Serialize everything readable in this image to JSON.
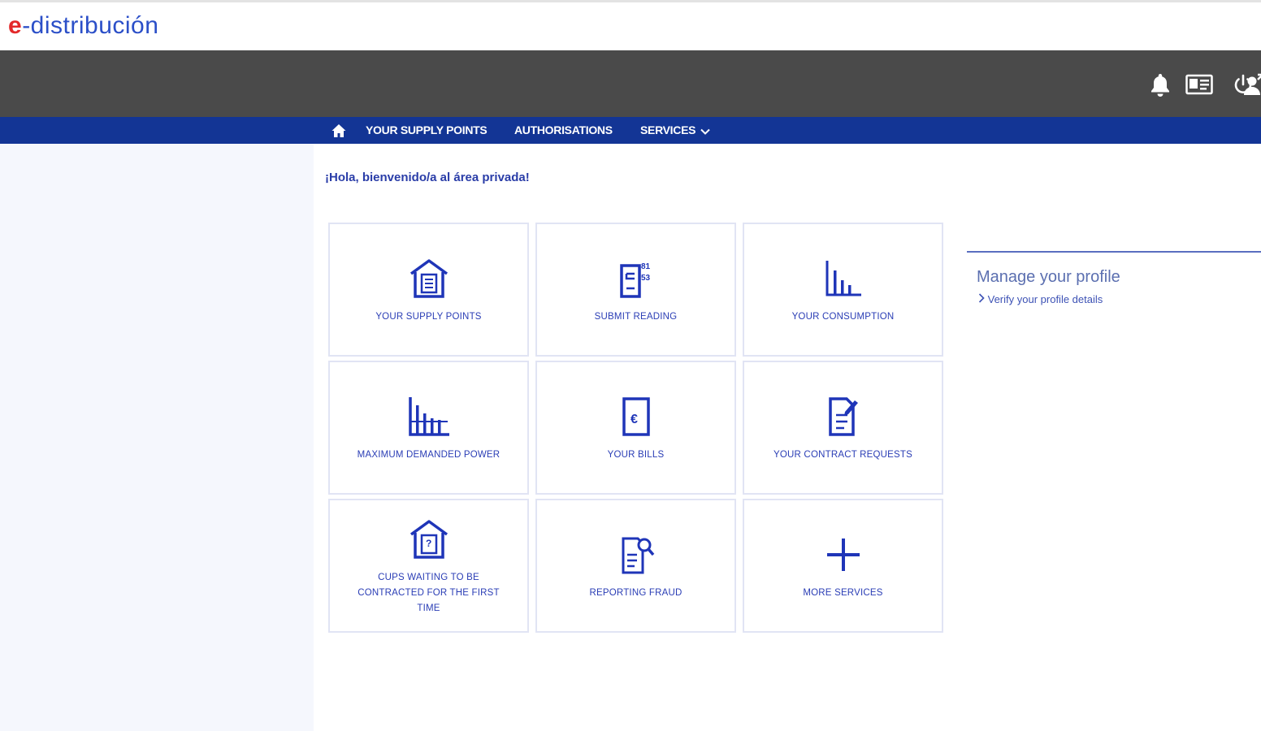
{
  "brand": {
    "logo_e": "e",
    "logo_rest": "-distribución"
  },
  "header": {
    "icons": [
      "bell-icon",
      "id-card-icon",
      "user-switch-icon",
      "power-icon"
    ]
  },
  "nav": {
    "home_icon": "home-icon",
    "items": [
      {
        "label": "YOUR SUPPLY POINTS"
      },
      {
        "label": "AUTHORISATIONS"
      },
      {
        "label": "SERVICES"
      }
    ]
  },
  "main": {
    "welcome": "¡Hola, bienvenido/a al área privada!",
    "tiles": [
      {
        "label": "YOUR SUPPLY POINTS",
        "icon": "house-document-icon"
      },
      {
        "label": "SUBMIT READING",
        "icon": "meter-reading-icon"
      },
      {
        "label": "YOUR CONSUMPTION",
        "icon": "bar-chart-icon"
      },
      {
        "label": "MAXIMUM DEMANDED POWER",
        "icon": "power-chart-icon"
      },
      {
        "label": "YOUR BILLS",
        "icon": "euro-bill-icon"
      },
      {
        "label": "YOUR CONTRACT REQUESTS",
        "icon": "contract-edit-icon"
      },
      {
        "label": "CUPS WAITING TO BE CONTRACTED FOR THE FIRST TIME",
        "icon": "house-question-icon"
      },
      {
        "label": "REPORTING FRAUD",
        "icon": "document-search-icon"
      },
      {
        "label": "MORE SERVICES",
        "icon": "plus-icon"
      }
    ]
  },
  "profile": {
    "title": "Manage your profile",
    "link": "Verify your profile details"
  },
  "colors": {
    "brand_red": "#e3292a",
    "brand_blue": "#2b4fc8",
    "nav_blue": "#133595",
    "dark_bar": "#4a4a4a",
    "icon_blue": "#1f35b8"
  }
}
